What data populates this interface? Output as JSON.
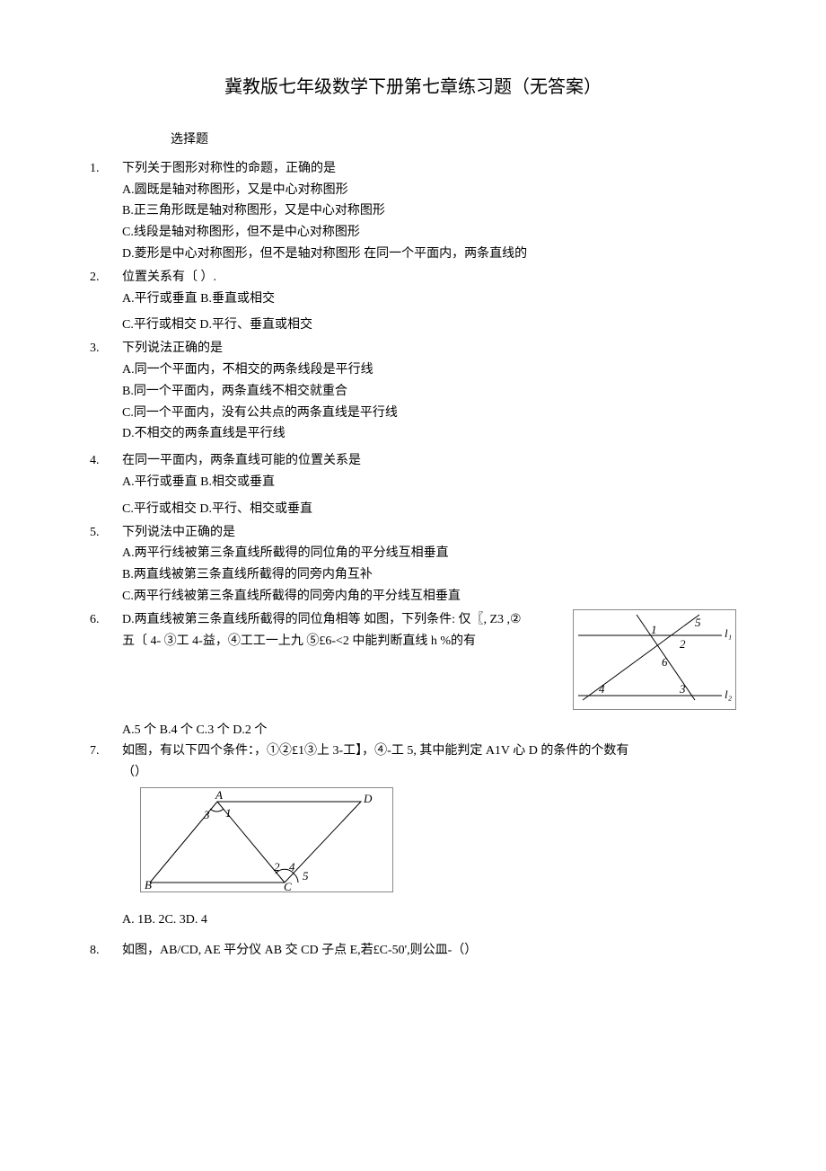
{
  "title": "冀教版七年级数学下册第七章练习题（无答案）",
  "section": "选择题",
  "q1": {
    "num": "1.",
    "text": "下列关于图形对称性的命题，正确的是",
    "optA": "A.圆既是轴对称图形，又是中心对称图形",
    "optB": "B.正三角形既是轴对称图形，又是中心对称图形",
    "optC": "C.线段是轴对称图形，但不是中心对称图形",
    "optD_prefix": "D.菱形是中心对称图形，但不是轴对称图形 在同一个平面内，两条直线的"
  },
  "q2": {
    "num": "2.",
    "line1": "位置关系有〔 ）.",
    "line2": "A.平行或垂直 B.垂直或相交",
    "line3": "C.平行或相交 D.平行、垂直或相交"
  },
  "q3": {
    "num": "3.",
    "text": "下列说法正确的是",
    "optA": "A.同一个平面内，不相交的两条线段是平行线",
    "optB": "B.同一个平面内，两条直线不相交就重合",
    "optC": "C.同一个平面内，没有公共点的两条直线是平行线",
    "optD": "D.不相交的两条直线是平行线"
  },
  "q4": {
    "num": "4.",
    "text": "在同一平面内，两条直线可能的位置关系是",
    "line1": "A.平行或垂直 B.相交或垂直",
    "line2": "C.平行或相交 D.平行、相交或垂直"
  },
  "q5": {
    "num": "5.",
    "text": "下列说法中正确的是",
    "optA": "A.两平行线被第三条直线所截得的同位角的平分线互相垂直",
    "optB": "B.两直线被第三条直线所截得的同旁内角互补",
    "optC": "C.两平行线被第三条直线所截得的同旁内角的平分线互相垂直"
  },
  "q6": {
    "num": "6.",
    "line1": "D.两直线被第三条直线所截得的同位角相等  如图，下列条件: 仅〖, Z3 ,②",
    "line2": "五〔 4- ③工 4-益，④工工一上九  ⑤£6-<2 中能判断直线  h %的有",
    "answers": "A.5 个 B.4 个 C.3 个 D.2 个",
    "fig": {
      "l1": "l₁",
      "l2": "l₂",
      "n1": "1",
      "n2": "2",
      "n3": "3",
      "n4": "4",
      "n5": "5",
      "n6": "6"
    }
  },
  "q7": {
    "num": "7.",
    "text": "如图，有以下四个条件：，①②£1③上 3-工】，④-工 5, 其中能判定 A1V 心 D 的条件的个数有",
    "paren": "（）",
    "answers": "A. 1B. 2C. 3D. 4",
    "fig": {
      "A": "A",
      "B": "B",
      "C": "C",
      "D": "D",
      "n1": "1",
      "n2": "2",
      "n3": "3",
      "n4": "4",
      "n5": "5"
    }
  },
  "q8": {
    "num": "8.",
    "text": "如图，AB/CD, AE 平分仪 AB 交 CD 子点 E,若£C-50',则公皿-（）"
  }
}
